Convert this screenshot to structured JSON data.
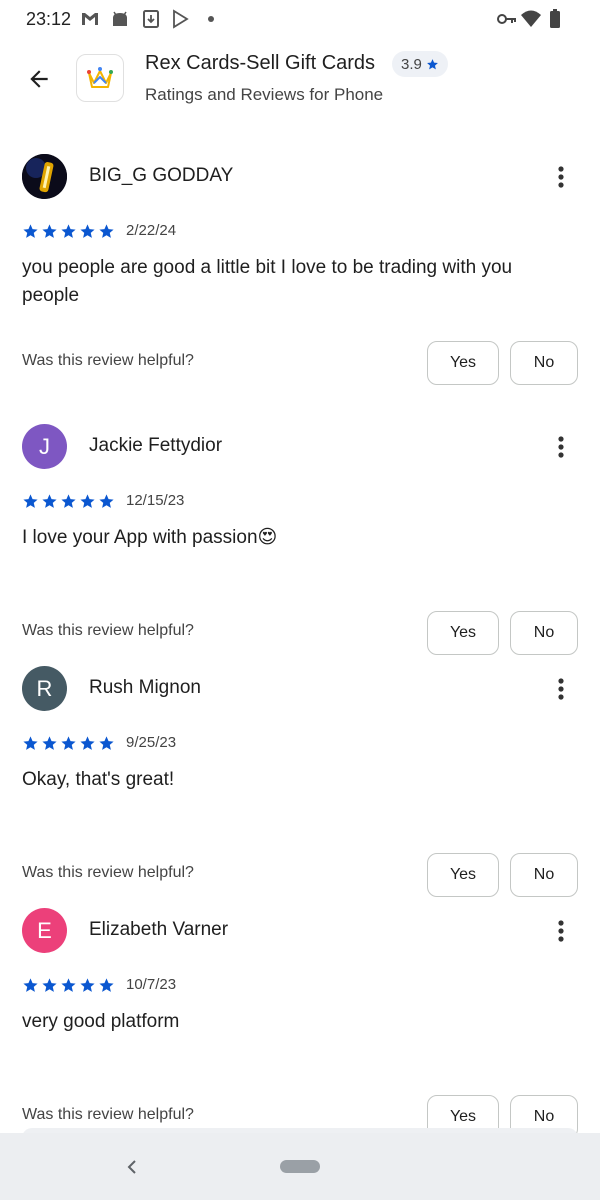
{
  "status_bar": {
    "time": "23:12",
    "left_icons": [
      "gmail-icon",
      "android-icon",
      "download-icon",
      "play-store-icon",
      "dot-icon"
    ],
    "right_icons": [
      "vpn-key-icon",
      "wifi-icon",
      "battery-icon"
    ]
  },
  "header": {
    "app_name": "Rex Cards-Sell Gift Cards",
    "rating": "3.9",
    "subtitle": "Ratings and Reviews for Phone"
  },
  "reviews": [
    {
      "name": "BIG_G GODDAY",
      "avatar_letter": "",
      "avatar_color": "#0b0b1a",
      "stars": 5,
      "date": "2/22/24",
      "text": "you people are good a little bit I love to be trading with you people"
    },
    {
      "name": "Jackie Fettydior",
      "avatar_letter": "J",
      "avatar_color": "#7e57c2",
      "stars": 5,
      "date": "12/15/23",
      "text": "I love your App with passion😍"
    },
    {
      "name": "Rush Mignon",
      "avatar_letter": "R",
      "avatar_color": "#455a64",
      "stars": 5,
      "date": "9/25/23",
      "text": "Okay, that's great!"
    },
    {
      "name": "Elizabeth Varner",
      "avatar_letter": "E",
      "avatar_color": "#ec407a",
      "stars": 5,
      "date": "10/7/23",
      "text": "very good platform"
    }
  ],
  "helpful": {
    "question": "Was this review helpful?",
    "yes_label": "Yes",
    "no_label": "No"
  },
  "colors": {
    "star": "#0b57d0",
    "accent": "#0b57d0"
  }
}
